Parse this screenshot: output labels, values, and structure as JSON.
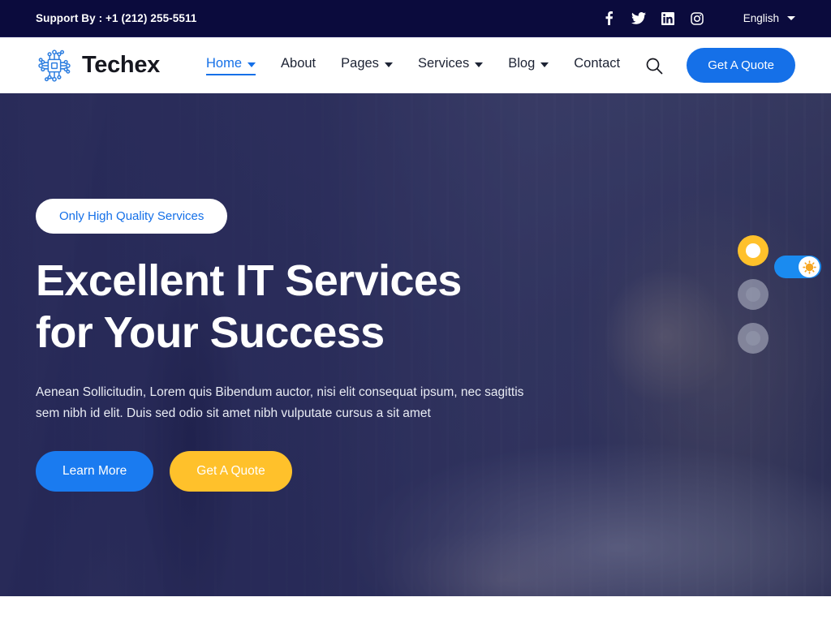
{
  "topbar": {
    "support_text": "Support By : +1 (212) 255-5511",
    "social": [
      {
        "name": "facebook-icon",
        "label": "Facebook"
      },
      {
        "name": "twitter-icon",
        "label": "Twitter"
      },
      {
        "name": "linkedin-icon",
        "label": "LinkedIn"
      },
      {
        "name": "instagram-icon",
        "label": "Instagram"
      }
    ],
    "language": "English",
    "background_color": "#0b0b3d"
  },
  "header": {
    "brand_name": "Techex",
    "brand_icon": "circuit-chip-icon",
    "nav": [
      {
        "label": "Home",
        "has_dropdown": true,
        "active": true
      },
      {
        "label": "About",
        "has_dropdown": false,
        "active": false
      },
      {
        "label": "Pages",
        "has_dropdown": true,
        "active": false
      },
      {
        "label": "Services",
        "has_dropdown": true,
        "active": false
      },
      {
        "label": "Blog",
        "has_dropdown": true,
        "active": false
      },
      {
        "label": "Contact",
        "has_dropdown": false,
        "active": false
      }
    ],
    "search_icon": "search-icon",
    "quote_button": "Get A Quote",
    "accent_color": "#1570e8"
  },
  "hero": {
    "badge": "Only High Quality Services",
    "title_line1": "Excellent IT Services",
    "title_line2": "for Your Success",
    "description": "Aenean Sollicitudin, Lorem quis Bibendum auctor, nisi elit consequat ipsum, nec sagittis sem nibh id elit. Duis sed odio sit amet nibh vulputate cursus a sit amet",
    "primary_button": "Learn More",
    "secondary_button": "Get A Quote",
    "primary_color": "#1a7bf0",
    "secondary_color": "#ffc12b",
    "slider_dots": [
      {
        "index": 1,
        "active": true
      },
      {
        "index": 2,
        "active": false
      },
      {
        "index": 3,
        "active": false
      }
    ],
    "theme_toggle": {
      "state": "on",
      "icon": "sun-icon"
    }
  }
}
